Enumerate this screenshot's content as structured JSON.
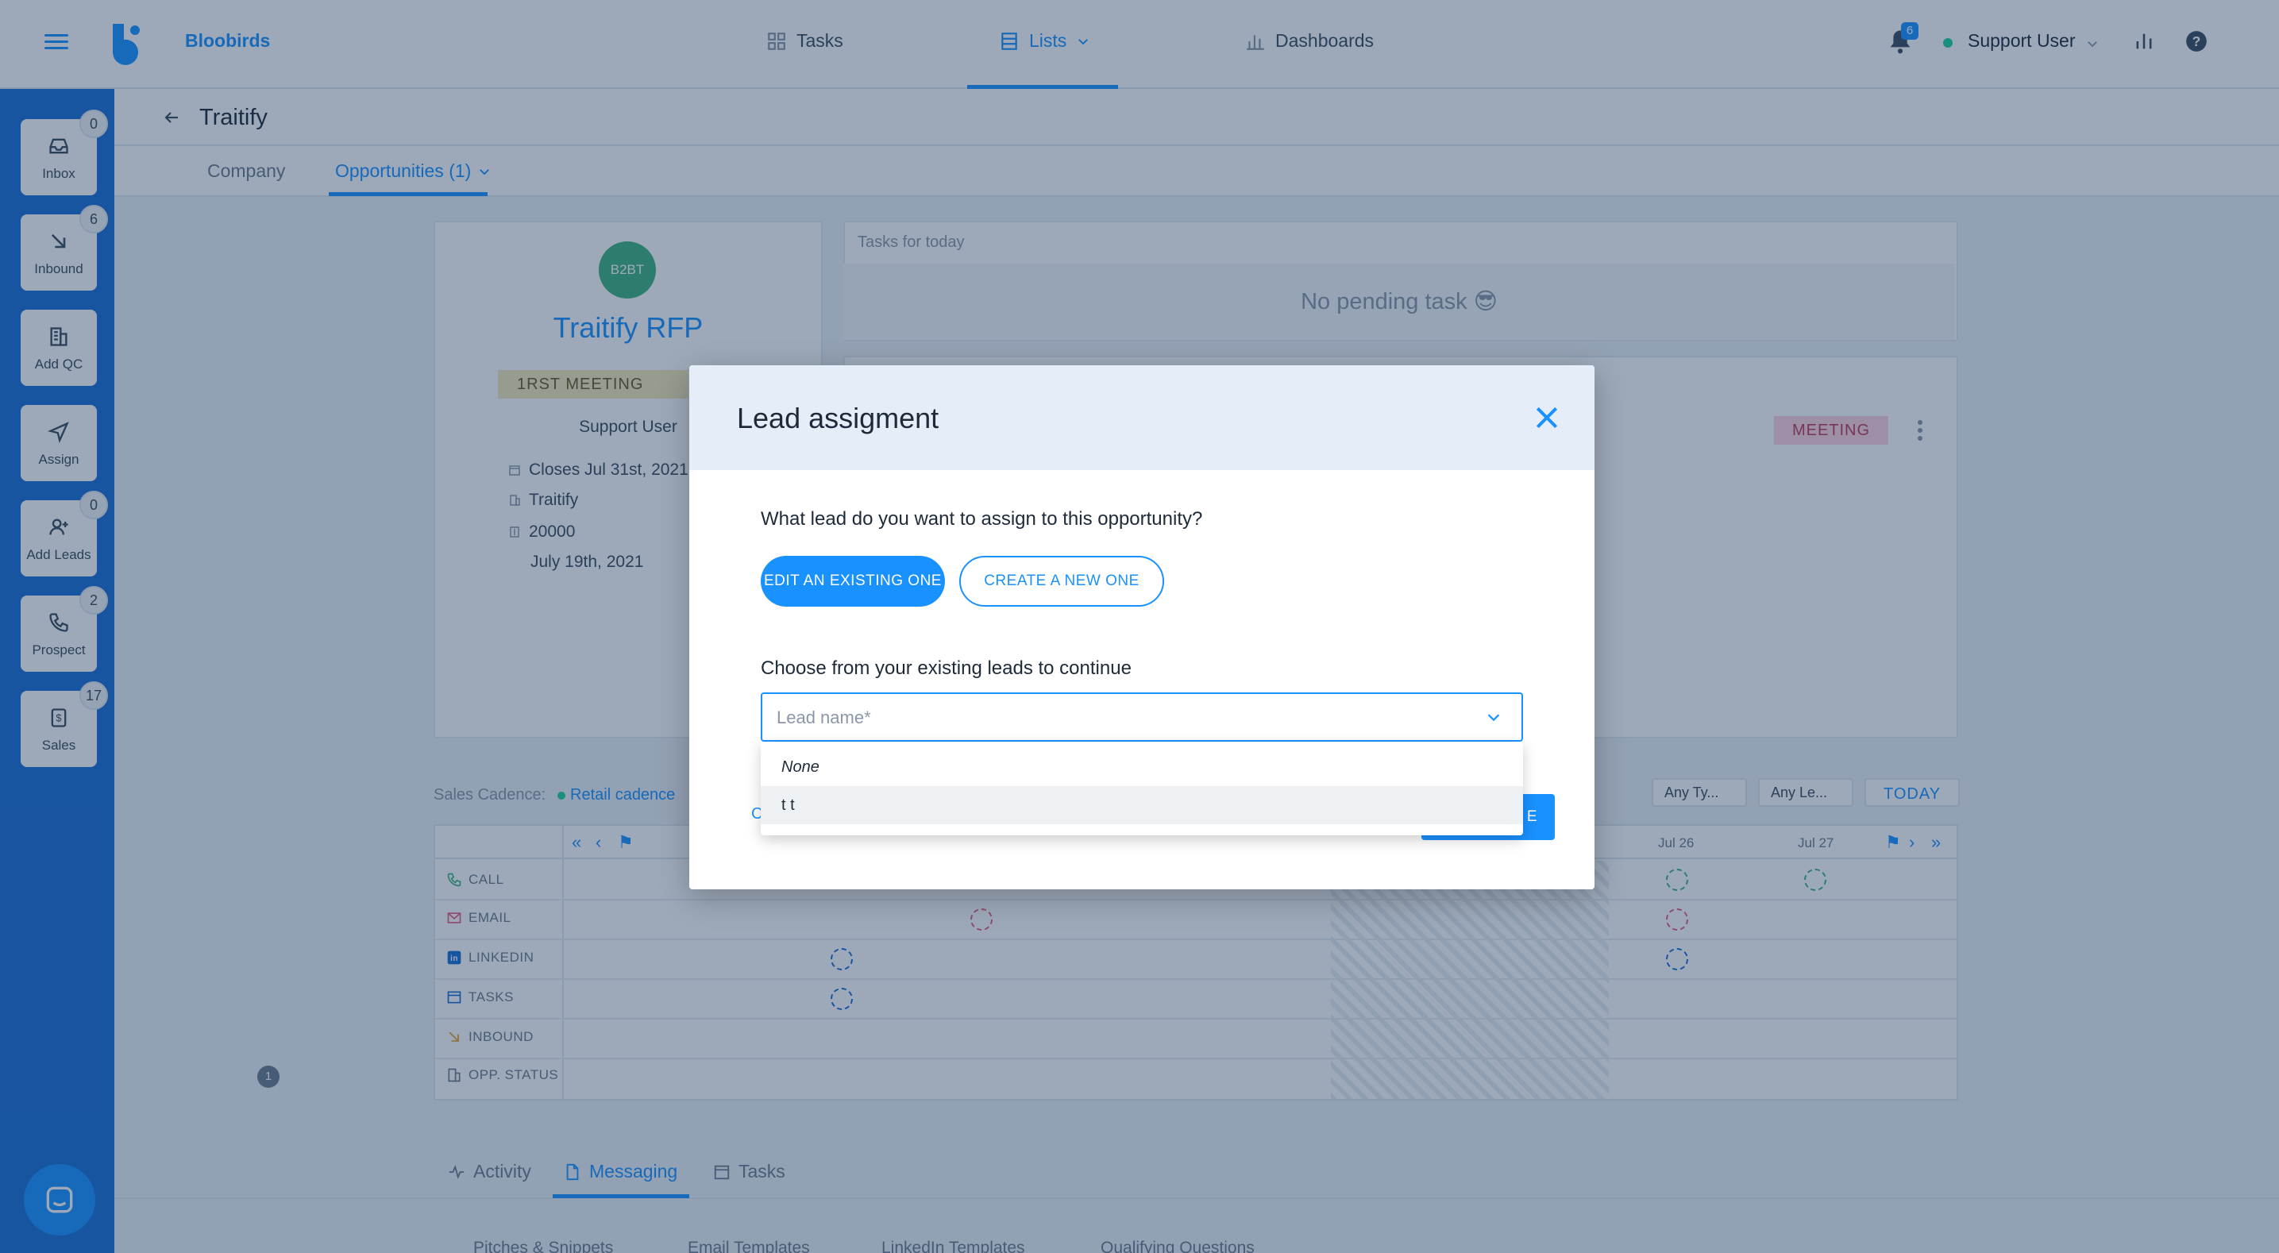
{
  "app": {
    "brand": "Bloobirds",
    "nav": [
      {
        "label": "Tasks",
        "icon": "grid-icon"
      },
      {
        "label": "Lists",
        "icon": "list-icon"
      },
      {
        "label": "Dashboards",
        "icon": "bar-chart-icon"
      }
    ],
    "notifications_count": "6",
    "user": "Support User"
  },
  "sidebar": {
    "items": [
      {
        "label": "Inbox",
        "badge": "0",
        "icon": "inbox-icon"
      },
      {
        "label": "Inbound",
        "badge": "6",
        "icon": "arrow-down-right-icon"
      },
      {
        "label": "Add QC",
        "badge": "",
        "icon": "building-icon"
      },
      {
        "label": "Assign",
        "badge": "",
        "icon": "send-icon"
      },
      {
        "label": "Add Leads",
        "badge": "0",
        "icon": "add-person-icon"
      },
      {
        "label": "Prospect",
        "badge": "2",
        "icon": "phone-icon"
      },
      {
        "label": "Sales",
        "badge": "17",
        "icon": "dollar-icon"
      }
    ]
  },
  "page": {
    "title": "Traitify",
    "tabs": {
      "company": "Company",
      "opportunities": "Opportunities (1)"
    }
  },
  "opportunity": {
    "avatar": "B2BT",
    "name": "Traitify RFP",
    "stage": "1RST MEETING DONE",
    "owner": "Support User",
    "closes": "Closes Jul 31st, 2021",
    "company": "Traitify",
    "amount": "20000",
    "created": "July 19th, 2021"
  },
  "tasks_panel": {
    "title": "Tasks for today",
    "empty": "No pending task 😎",
    "badge": "MEETING"
  },
  "cadence": {
    "label": "Sales Cadence:",
    "value": "Retail cadence",
    "filters": [
      "Any Ty...",
      "Any Le..."
    ],
    "today": "TODAY",
    "dates": [
      "Jul 26",
      "Jul 27"
    ],
    "rows": [
      "CALL",
      "EMAIL",
      "LINKEDIN",
      "TASKS",
      "INBOUND",
      "OPP. STATUS"
    ],
    "opp_marker": "1"
  },
  "bottom": {
    "tabs": [
      "Activity",
      "Messaging",
      "Tasks"
    ],
    "subtabs": [
      "Pitches & Snippets",
      "Email Templates",
      "LinkedIn Templates",
      "Qualifying Questions"
    ]
  },
  "modal": {
    "title": "Lead assigment",
    "question": "What lead do you want to assign to this opportunity?",
    "edit_existing": "EDIT AN EXISTING ONE",
    "create_new": "CREATE A NEW ONE",
    "choose_label": "Choose from your existing leads to continue",
    "select_placeholder": "Lead name*",
    "options": [
      "None",
      "t t"
    ],
    "cancel_peek": "C",
    "continue_peek": "E"
  },
  "colors": {
    "accent": "#1991ff",
    "sidebar": "#1b6fd4",
    "stage_badge": "#f5e9b8",
    "meeting_badge": "#ffd3de",
    "online": "#1fd39b"
  }
}
